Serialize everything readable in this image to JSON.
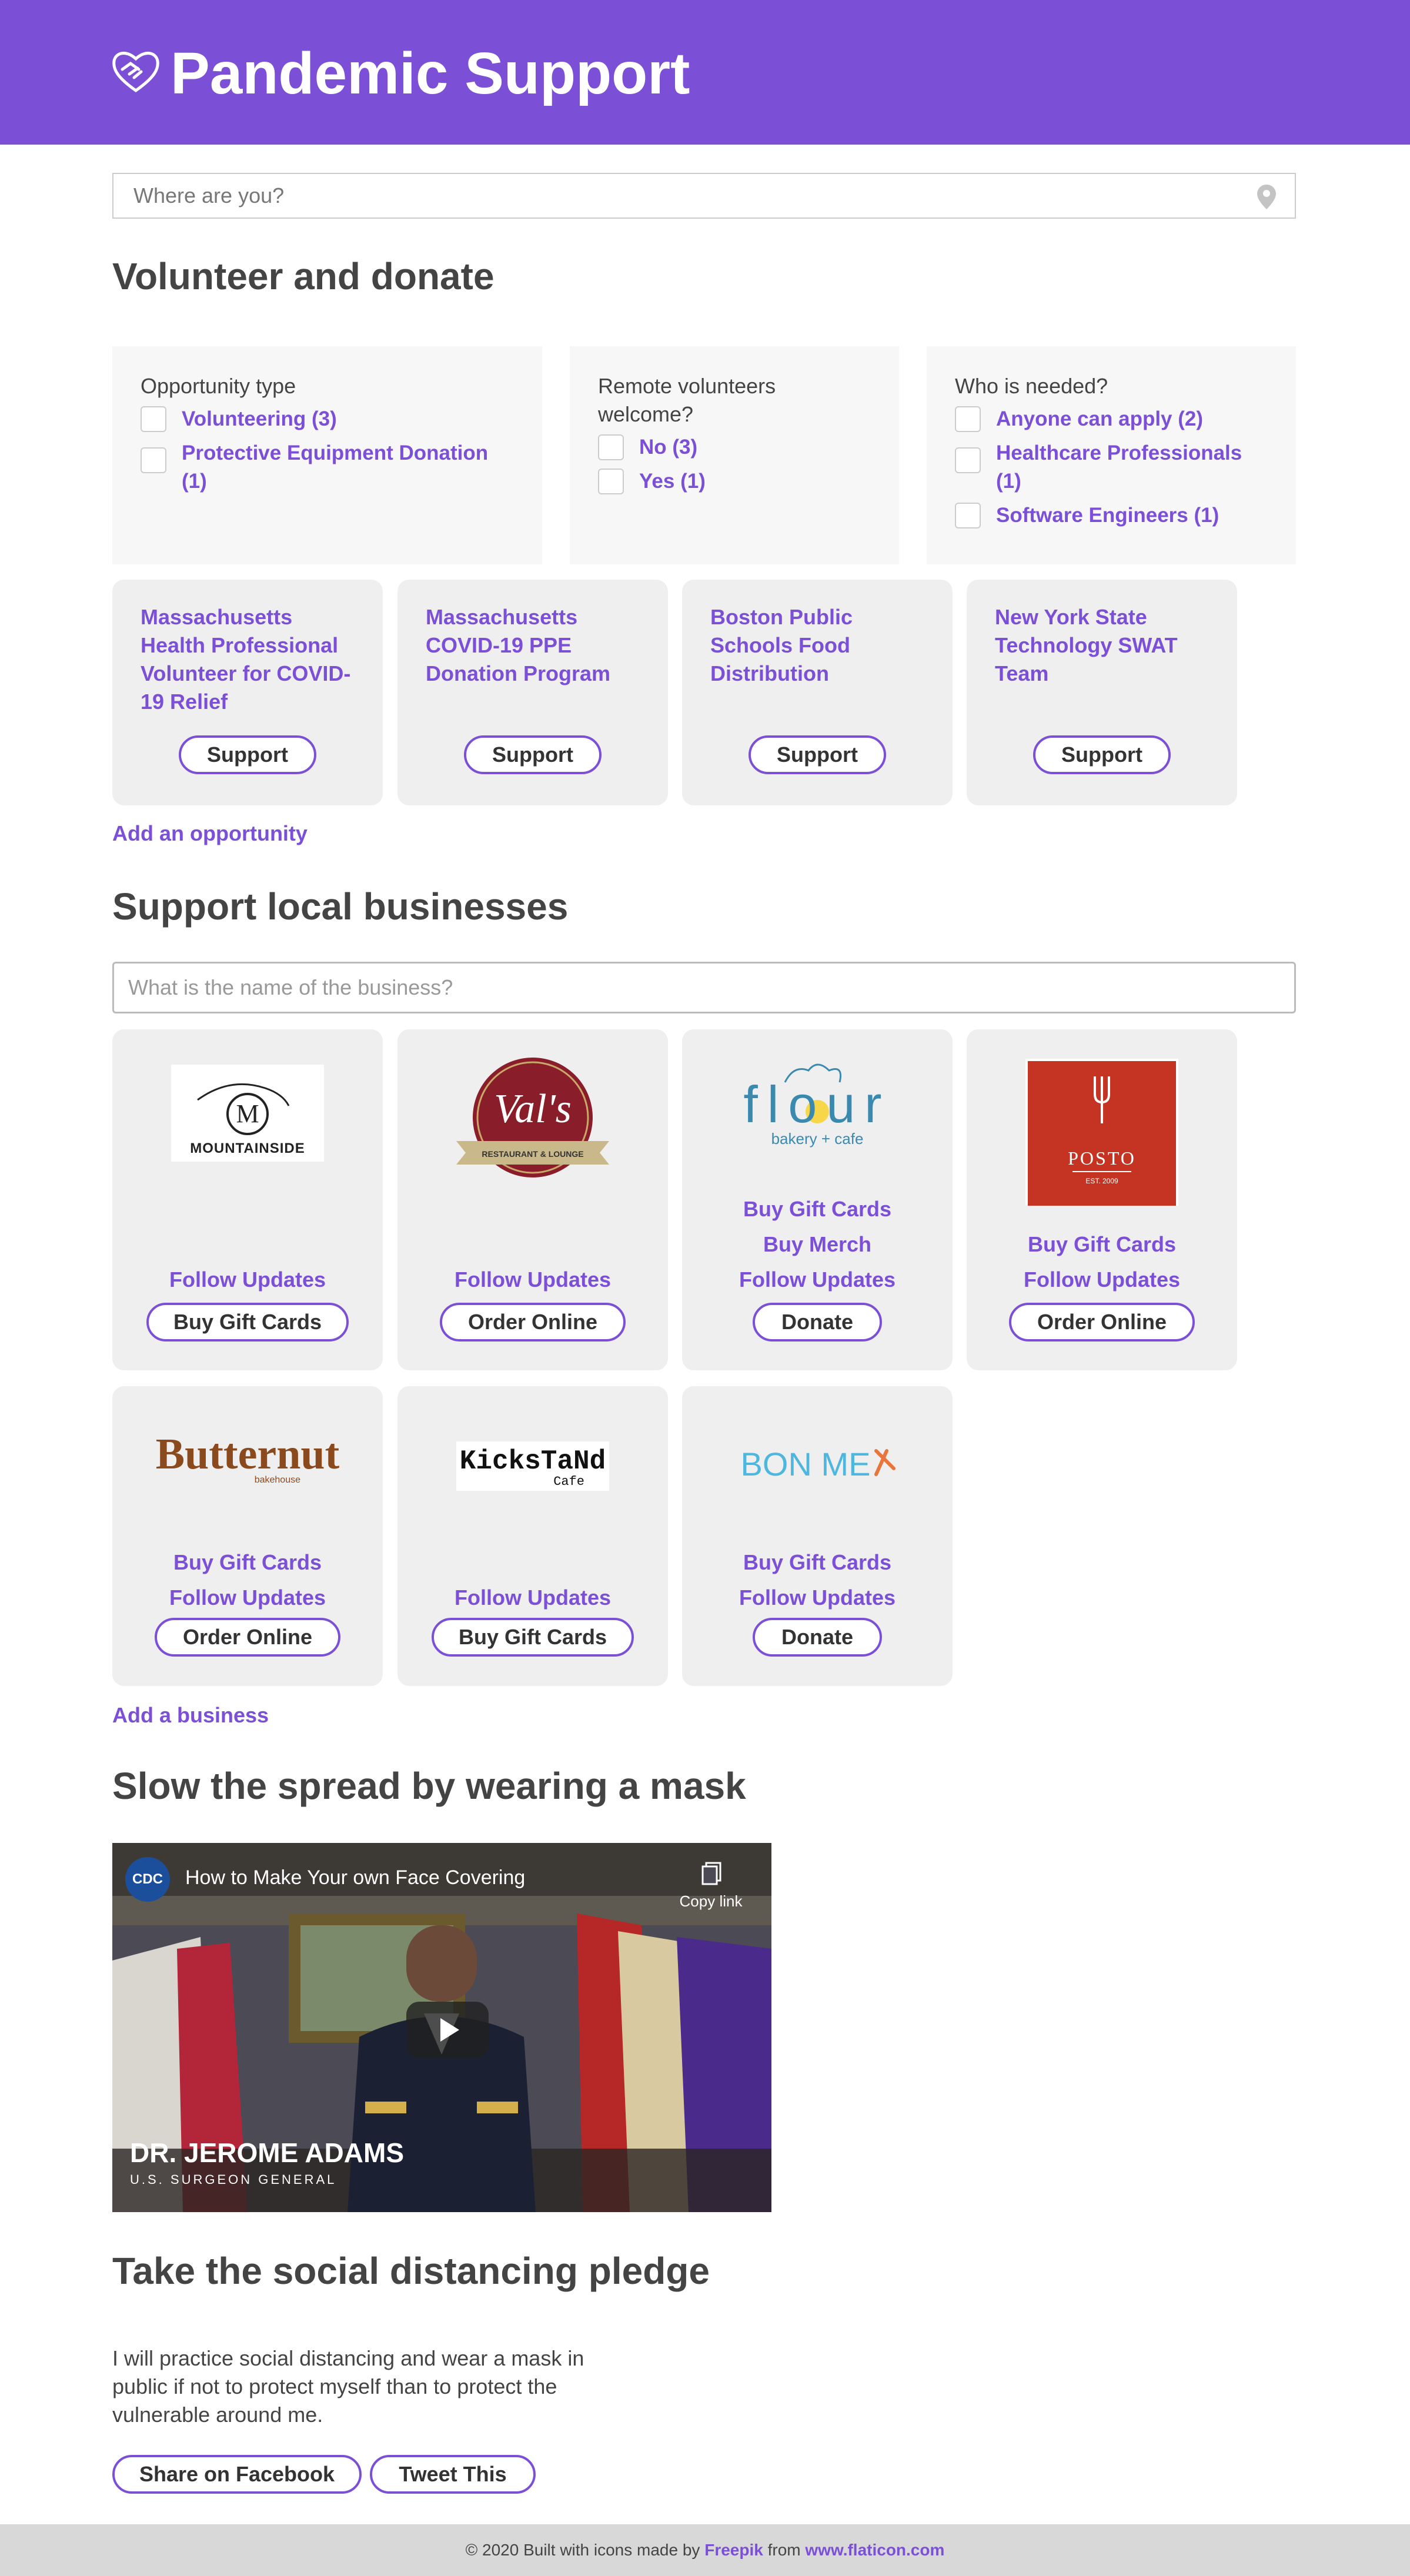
{
  "header": {
    "title": "Pandemic Support",
    "logo_icon": "heart-handshake-icon"
  },
  "location": {
    "placeholder": "Where are you?",
    "icon": "map-pin-icon"
  },
  "volunteer": {
    "heading": "Volunteer and donate",
    "filters": [
      {
        "title": "Opportunity type",
        "options": [
          "Volunteering (3)",
          "Protective Equipment Donation (1)"
        ]
      },
      {
        "title": "Remote volunteers welcome?",
        "options": [
          "No (3)",
          "Yes (1)"
        ]
      },
      {
        "title": "Who is needed?",
        "options": [
          "Anyone can apply (2)",
          "Healthcare Professionals (1)",
          "Software Engineers (1)"
        ]
      }
    ],
    "opportunities": [
      {
        "title": "Massachusetts Health Professional Volunteer for COVID-19 Relief",
        "button": "Support"
      },
      {
        "title": "Massachusetts COVID-19 PPE Donation Program",
        "button": "Support"
      },
      {
        "title": "Boston Public Schools Food Distribution",
        "button": "Support"
      },
      {
        "title": "New York State Technology SWAT Team",
        "button": "Support"
      }
    ],
    "add_link": "Add an opportunity"
  },
  "businesses": {
    "heading": "Support local businesses",
    "search_placeholder": "What is the name of the business?",
    "items": [
      {
        "logo_text": "MOUNTAINSIDE",
        "logo_letter": "M",
        "links": [
          "Follow Updates"
        ],
        "button": "Buy Gift Cards"
      },
      {
        "logo_text": "Val's",
        "logo_sub": "RESTAURANT & LOUNGE",
        "links": [
          "Follow Updates"
        ],
        "button": "Order Online"
      },
      {
        "logo_text": "flour",
        "logo_sub": "bakery + cafe",
        "links": [
          "Buy Gift Cards",
          "Buy Merch",
          "Follow Updates"
        ],
        "button": "Donate"
      },
      {
        "logo_text": "POSTO",
        "logo_sub": "EST. 2009",
        "links": [
          "Buy Gift Cards",
          "Follow Updates"
        ],
        "button": "Order Online"
      },
      {
        "logo_text": "Butternut",
        "logo_sub": "bakehouse",
        "links": [
          "Buy Gift Cards",
          "Follow Updates"
        ],
        "button": "Order Online"
      },
      {
        "logo_text": "KicksTaNd",
        "logo_sub": "Cafe",
        "links": [
          "Follow Updates"
        ],
        "button": "Buy Gift Cards"
      },
      {
        "logo_text": "BON ME",
        "links": [
          "Buy Gift Cards",
          "Follow Updates"
        ],
        "button": "Donate"
      }
    ],
    "add_link": "Add a business"
  },
  "mask": {
    "heading": "Slow the spread by wearing a mask",
    "video": {
      "channel_badge": "CDC",
      "title": "How to Make Your own Face Covering",
      "copy_label": "Copy link",
      "caption_name": "DR. JEROME ADAMS",
      "caption_role": "U.S. SURGEON GENERAL"
    }
  },
  "pledge": {
    "heading": "Take the social distancing pledge",
    "text": "I will practice social distancing and wear a mask in public if not to protect myself than to protect the vulnerable around me.",
    "facebook_button": "Share on Facebook",
    "tweet_button": "Tweet This"
  },
  "footer": {
    "prefix": "© 2020 Built with icons made by",
    "freepik": "Freepik",
    "from": "from",
    "flaticon": "www.flaticon.com"
  },
  "colors": {
    "brand": "#7b4fd6",
    "card": "#efefef",
    "filter_bg": "#f7f7f7",
    "footer": "#d8d8d8"
  }
}
